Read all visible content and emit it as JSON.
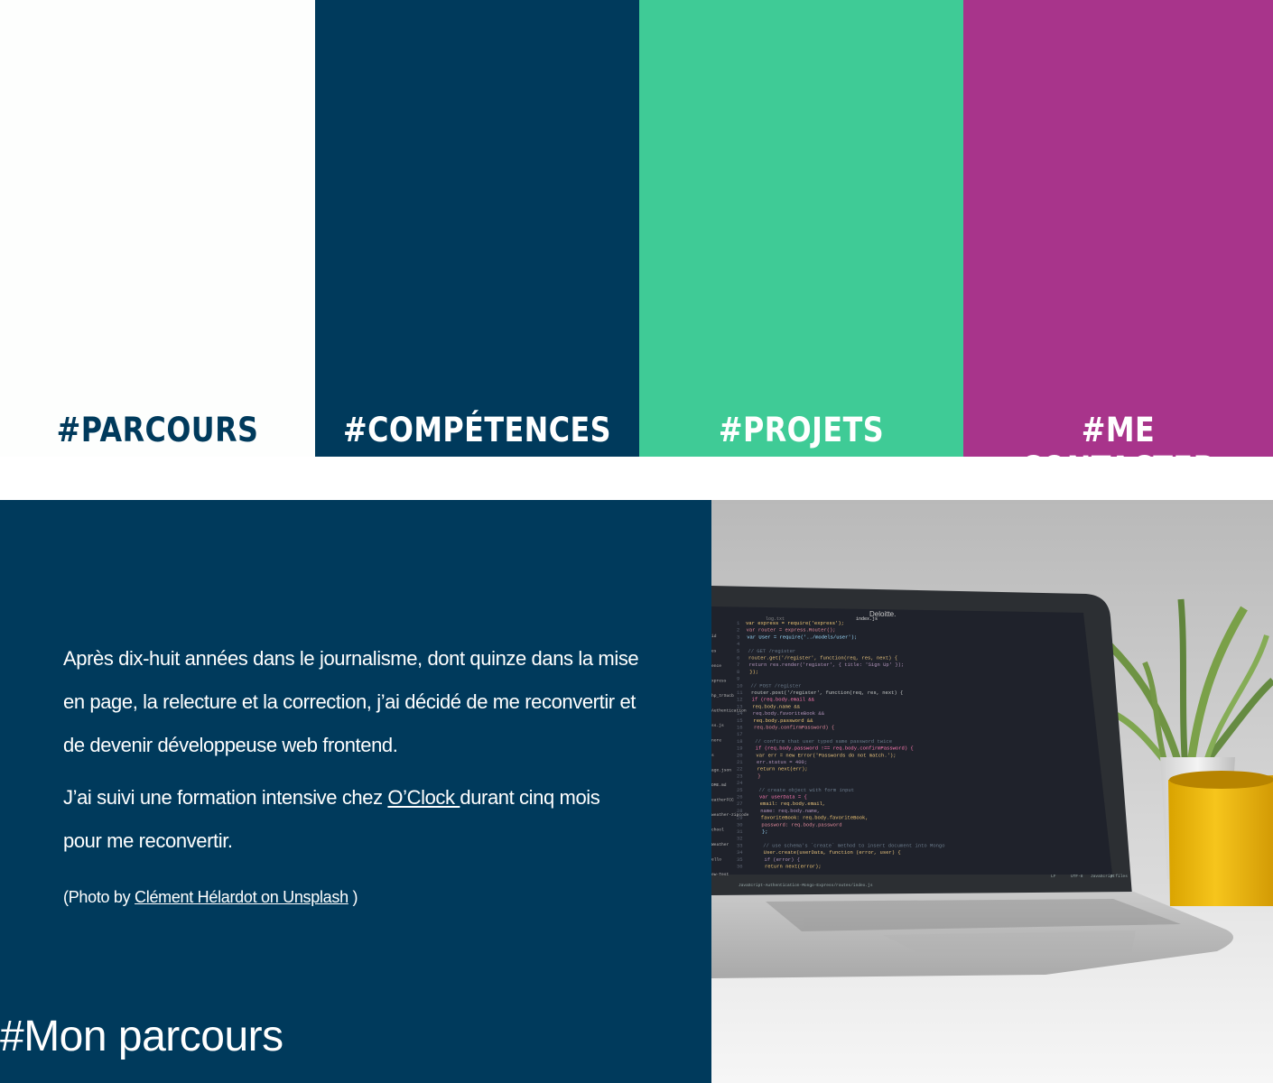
{
  "nav": {
    "items": [
      {
        "label": "#PARCOURS",
        "color": "#fdfefd",
        "text_color": "#003a5c"
      },
      {
        "label": "#COMPÉTENCES",
        "color": "#003a5c",
        "text_color": "#ffffff"
      },
      {
        "label": "#PROJETS",
        "color": "#3fcb96",
        "text_color": "#ffffff"
      },
      {
        "label": "#ME CONTACTER",
        "color": "#a8348b",
        "text_color": "#ffffff"
      }
    ]
  },
  "parcours": {
    "title": "#Mon parcours",
    "paragraph1": "Après dix-huit années dans le journalisme, dont quinze dans la mise en page, la relecture et la correction, j’ai décidé de me reconvertir et de devenir développeuse web frontend.",
    "paragraph2_before": "J’ai suivi une formation intensive chez ",
    "paragraph2_link": "O’Clock ",
    "paragraph2_after": "durant cinq mois pour me reconvertir.",
    "credit_before": "(Photo by ",
    "credit_link": "Clément Hélardot on Unsplash",
    "credit_after": " )",
    "background_color": "#003a5c"
  },
  "photo": {
    "screen_brand": "Deloitte.",
    "tab_names": [
      "log.txt",
      "index.js"
    ],
    "code_lines": [
      "var express = require('express');",
      "var router = express.Router();",
      "var User = require('../models/user');",
      "",
      "// GET /register",
      "router.get('/register', function(req, res, next) {",
      "  return res.render('register', { title: 'Sign Up' });",
      "});",
      "",
      "// POST /register",
      "router.post('/register', function(req, res, next) {",
      "  if (req.body.email &&",
      "    req.body.name &&",
      "    req.body.favoriteBook &&",
      "    req.body.password &&",
      "    req.body.confirmPassword) {",
      "",
      "    // confirm that user typed same password twice",
      "    if (req.body.password !== req.body.confirmPassword) {",
      "      var err = new Error('Passwords do not match.');",
      "      err.status = 400;",
      "      return next(err);",
      "    }",
      "",
      "    // create object with form input",
      "    var userData = {",
      "      email: req.body.email,",
      "      name: req.body.name,",
      "      favoriteBook: req.body.favoriteBook,",
      "      password: req.body.password",
      "    };",
      "",
      "    // use schema's `create` method to insert document into Mongo",
      "    User.create(userData, function (error, user) {",
      "      if (error) {",
      "        return next(error);"
    ],
    "sidebar_items": [
      "id",
      "es",
      "ence",
      "xpress",
      "hp_trSucb",
      "Authentication",
      "ss.js",
      "nore",
      "s",
      "age.json",
      "DME.md",
      "eatherFCC",
      "weather-zipcode",
      "chool",
      "Weather",
      "ello",
      "ew-Test"
    ],
    "status_path": "JavaScript-Authentication-Mongo-Express/routes/index.js",
    "status_right": [
      "LF",
      "UTF-8",
      "JavaScript",
      "0 files"
    ]
  }
}
